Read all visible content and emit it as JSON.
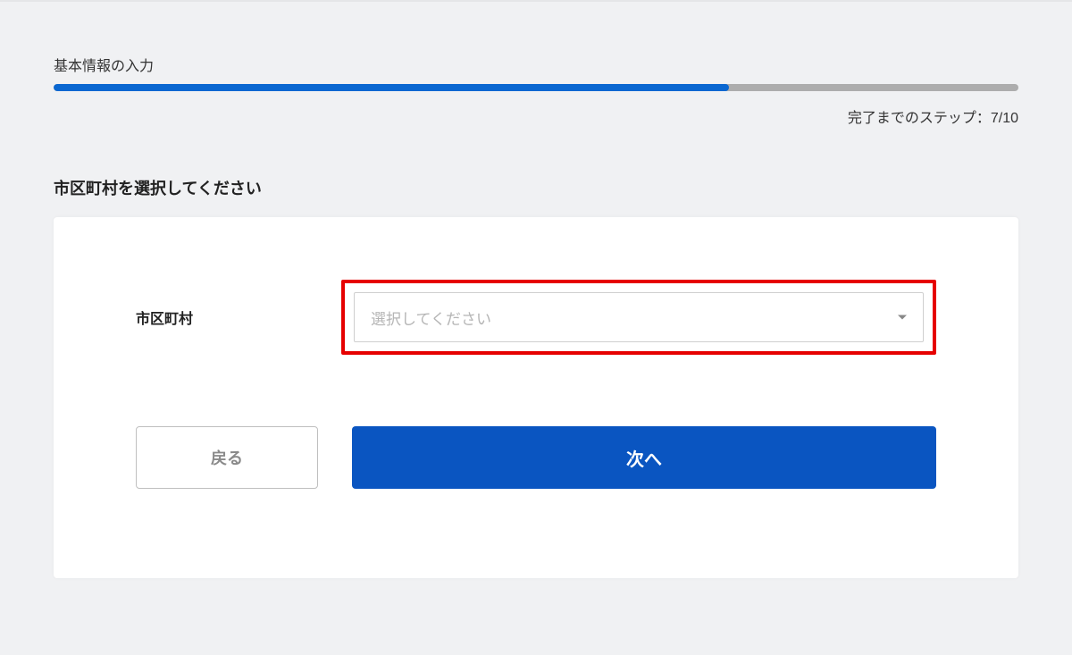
{
  "progress": {
    "title": "基本情報の入力",
    "counter_prefix": "完了までのステップ：",
    "current": "7",
    "total": "10",
    "percent": 70
  },
  "question": {
    "heading": "市区町村を選択してください",
    "field_label": "市区町村",
    "select_placeholder": "選択してください"
  },
  "buttons": {
    "back": "戻る",
    "next": "次へ"
  }
}
